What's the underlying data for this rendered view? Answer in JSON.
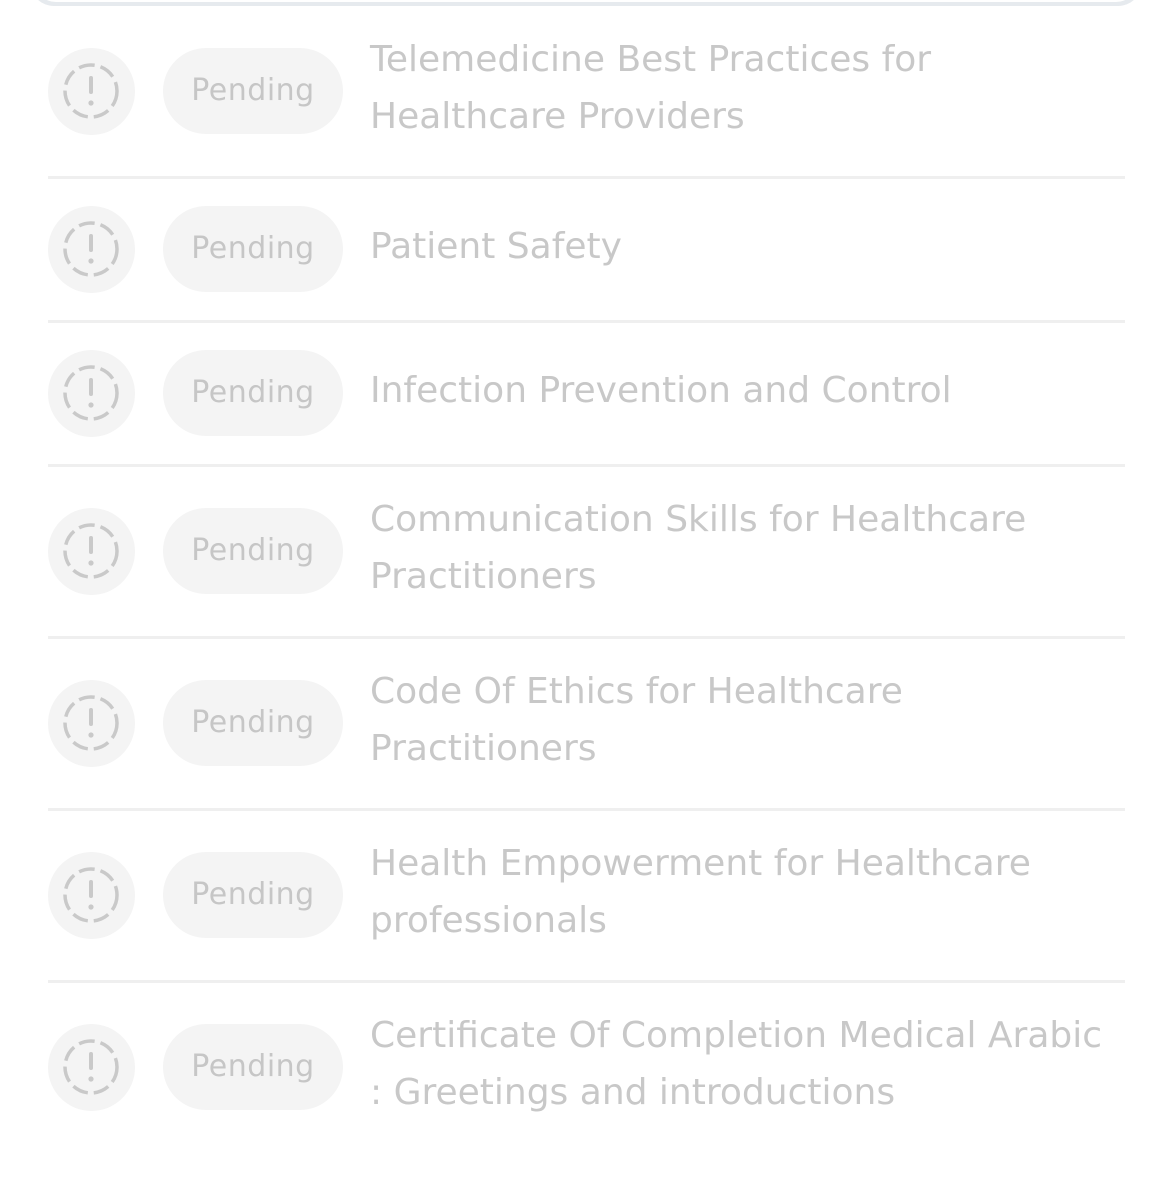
{
  "courses": [
    {
      "status": "Pending",
      "title": "Telemedicine Best Practices for Healthcare Providers",
      "icon": "alert-circle-icon"
    },
    {
      "status": "Pending",
      "title": "Patient Safety",
      "icon": "alert-circle-icon"
    },
    {
      "status": "Pending",
      "title": "Infection Prevention and Control",
      "icon": "alert-circle-icon"
    },
    {
      "status": "Pending",
      "title": "Communication Skills for Healthcare Practitioners",
      "icon": "alert-circle-icon"
    },
    {
      "status": "Pending",
      "title": "Code Of Ethics for Healthcare Practitioners",
      "icon": "alert-circle-icon"
    },
    {
      "status": "Pending",
      "title": "Health Empowerment for Healthcare professionals",
      "icon": "alert-circle-icon"
    },
    {
      "status": "Pending",
      "title": "Certificate Of Completion Medical Arabic : Greetings and introductions",
      "icon": "alert-circle-icon"
    }
  ],
  "colors": {
    "text_muted": "#c8c8c8",
    "pill_bg": "#f4f4f4",
    "divider": "#efefef"
  }
}
